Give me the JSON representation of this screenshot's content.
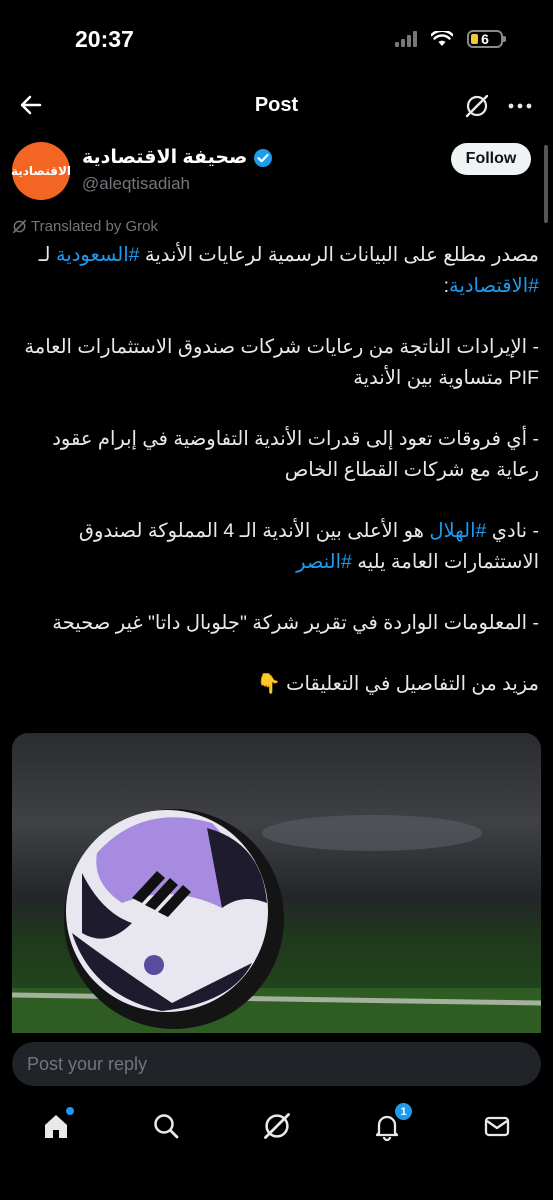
{
  "status": {
    "time": "20:37",
    "battery": "6"
  },
  "header": {
    "title": "Post",
    "icons": [
      "back-arrow-icon",
      "grok-icon",
      "more-icon"
    ]
  },
  "author": {
    "avatar_text": "الاقتصادية",
    "name": "صحيفة الاقتصادية",
    "handle": "@aleqtisadiah",
    "follow_label": "Follow",
    "verified": true
  },
  "translated_label": "Translated by Grok",
  "tweet": {
    "p1_a": "مصدر مطلع على البيانات الرسمية لرعايات الأندية ",
    "p1_h1": "#السعودية",
    "p1_b": " لـ ",
    "p1_h2": "#الاقتصادية",
    "p1_c": ":",
    "p2": "- الإيرادات الناتجة من رعايات شركات صندوق الاستثمارات العامة PIF متساوية بين الأندية",
    "p3": "- أي فروقات تعود إلى قدرات الأندية التفاوضية في إبرام عقود رعاية مع شركات القطاع الخاص",
    "p4_a": "- نادي ",
    "p4_h1": "#الهلال",
    "p4_b": " هو الأعلى بين الأندية الـ 4 المملوكة لصندوق الاستثمارات العامة يليه ",
    "p4_h2": "#النصر",
    "p5": "- المعلومات الواردة في تقرير شركة \"جلوبال داتا\" غير صحيحة",
    "p6": "مزيد من التفاصيل في التعليقات 👇"
  },
  "reply": {
    "placeholder": "Post your reply"
  },
  "tabbar": {
    "notifications_badge": "1"
  },
  "colors": {
    "accent": "#1d9bf0",
    "background": "#000000",
    "avatar": "#f26522"
  }
}
